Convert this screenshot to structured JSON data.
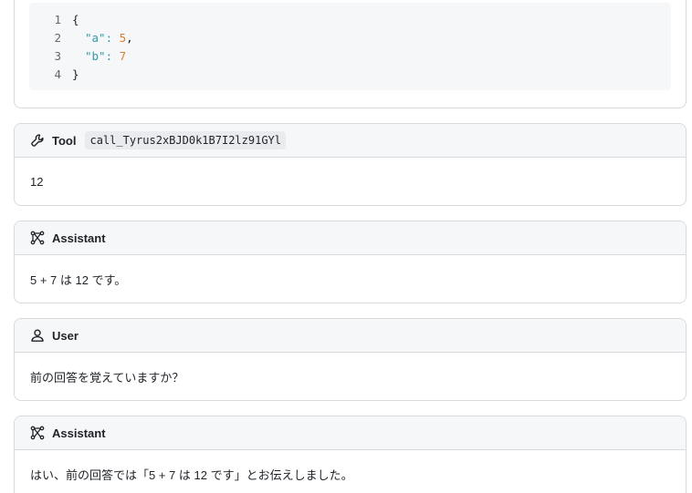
{
  "code": {
    "lines": [
      {
        "num": "1",
        "open": "{"
      },
      {
        "num": "2",
        "key": "\"a\"",
        "colon": ": ",
        "value": "5",
        "comma": ","
      },
      {
        "num": "3",
        "key": "\"b\"",
        "colon": ": ",
        "value": "7"
      },
      {
        "num": "4",
        "close": "}"
      }
    ]
  },
  "messages": [
    {
      "role": "Tool",
      "call_id": "call_Tyrus2xBJD0k1B7I2lz91GYl",
      "content": "12",
      "icon": "wrench-icon"
    },
    {
      "role": "Assistant",
      "content": "5 + 7 は 12 です。",
      "icon": "assistant-icon"
    },
    {
      "role": "User",
      "content": "前の回答を覚えていますか？",
      "icon": "user-icon"
    },
    {
      "role": "Assistant",
      "content": "はい、前の回答では「5 + 7 は 12 です」とお伝えしました。",
      "icon": "assistant-icon"
    }
  ]
}
